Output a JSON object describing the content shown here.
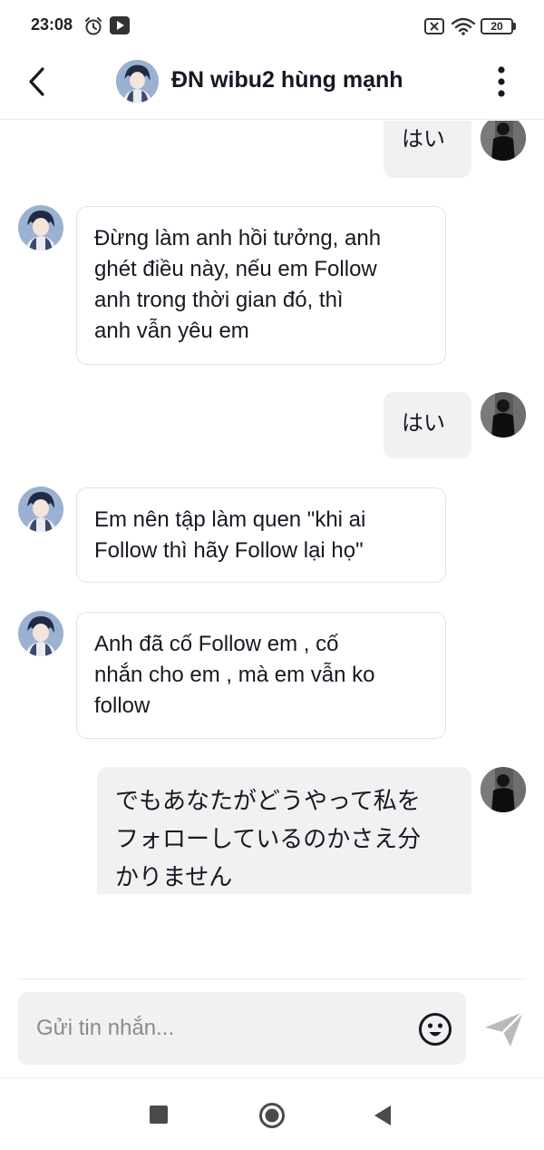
{
  "status_bar": {
    "time": "23:08",
    "battery": "20",
    "icons": [
      "alarm-icon",
      "media-icon",
      "sim-off-icon",
      "wifi-icon",
      "battery-icon"
    ]
  },
  "header": {
    "title": "ĐN wibu2 hùng mạnh",
    "back_icon": "chevron-left-icon",
    "more_icon": "more-vertical-icon"
  },
  "messages": [
    {
      "from": "me",
      "text": "はい"
    },
    {
      "from": "them",
      "lines": [
        "Đừng làm anh hồi tưởng, anh",
        "ghét điều này, nếu em Follow",
        "anh trong thời gian đó, thì",
        "anh vẫn yêu em"
      ]
    },
    {
      "from": "me",
      "text": "はい"
    },
    {
      "from": "them",
      "lines": [
        "Em nên tập làm quen \"khi ai",
        "Follow thì hãy Follow lại họ\""
      ]
    },
    {
      "from": "them",
      "lines": [
        "Anh đã cố Follow em , cố",
        "nhắn cho em , mà em vẫn ko",
        "follow"
      ]
    },
    {
      "from": "me",
      "lines": [
        "でもあなたがどうやって私を",
        "フォローしているのかさえ分",
        "かりません"
      ]
    }
  ],
  "composer": {
    "placeholder": "Gửi tin nhắn...",
    "emoji_icon": "emoji-icon",
    "send_icon": "send-icon"
  },
  "nav_bar": {
    "icons": [
      "recents-square-icon",
      "home-circle-icon",
      "back-triangle-icon"
    ]
  }
}
